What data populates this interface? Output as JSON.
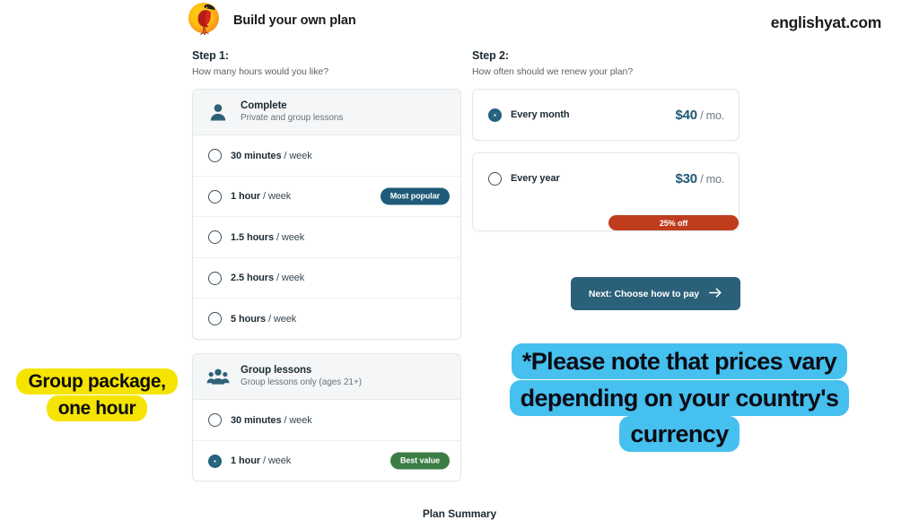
{
  "header": {
    "brand_title": "Build your own plan",
    "logo_icon": "bird-logo-icon",
    "watermark": "englishyat.com"
  },
  "step1": {
    "title": "Step 1:",
    "subtitle": "How many hours would you like?",
    "packages": [
      {
        "icon": "person-icon",
        "name": "Complete",
        "description": "Private and group lessons",
        "options": [
          {
            "amount": "30 minutes",
            "period": " / week",
            "selected": false,
            "badge": null
          },
          {
            "amount": "1 hour",
            "period": " / week",
            "selected": false,
            "badge": "Most popular",
            "badge_kind": "popular"
          },
          {
            "amount": "1.5 hours",
            "period": " / week",
            "selected": false,
            "badge": null
          },
          {
            "amount": "2.5 hours",
            "period": " / week",
            "selected": false,
            "badge": null
          },
          {
            "amount": "5 hours",
            "period": " / week",
            "selected": false,
            "badge": null
          }
        ]
      },
      {
        "icon": "group-people-icon",
        "name": "Group lessons",
        "description": "Group lessons only (ages 21+)",
        "options": [
          {
            "amount": "30 minutes",
            "period": " / week",
            "selected": false,
            "badge": null
          },
          {
            "amount": "1 hour",
            "period": " / week",
            "selected": true,
            "badge": "Best value",
            "badge_kind": "value"
          }
        ]
      }
    ]
  },
  "step2": {
    "title": "Step 2:",
    "subtitle": "How often should we renew your plan?",
    "billing_options": [
      {
        "label": "Every month",
        "price": "$40",
        "unit": "/ mo.",
        "selected": true,
        "discount": null
      },
      {
        "label": "Every year",
        "price": "$30",
        "unit": "/ mo.",
        "selected": false,
        "discount": "25% off"
      }
    ],
    "next_button": {
      "label": "Next: Choose how to pay",
      "icon": "arrow-right-icon"
    }
  },
  "annotations": {
    "yellow_note": "Group package, one hour",
    "blue_note": "*Please note that prices vary depending on your country's currency"
  },
  "footer": {
    "plan_summary": "Plan Summary"
  },
  "colors": {
    "brand_teal": "#2b6079",
    "selected_radio": "#23627d",
    "badge_popular": "#1e5b78",
    "badge_value": "#3c7d46",
    "discount_red": "#bf3c1d",
    "annotation_yellow": "#f5e400",
    "annotation_blue": "#45c0ef",
    "price_text": "#1f5a73"
  }
}
